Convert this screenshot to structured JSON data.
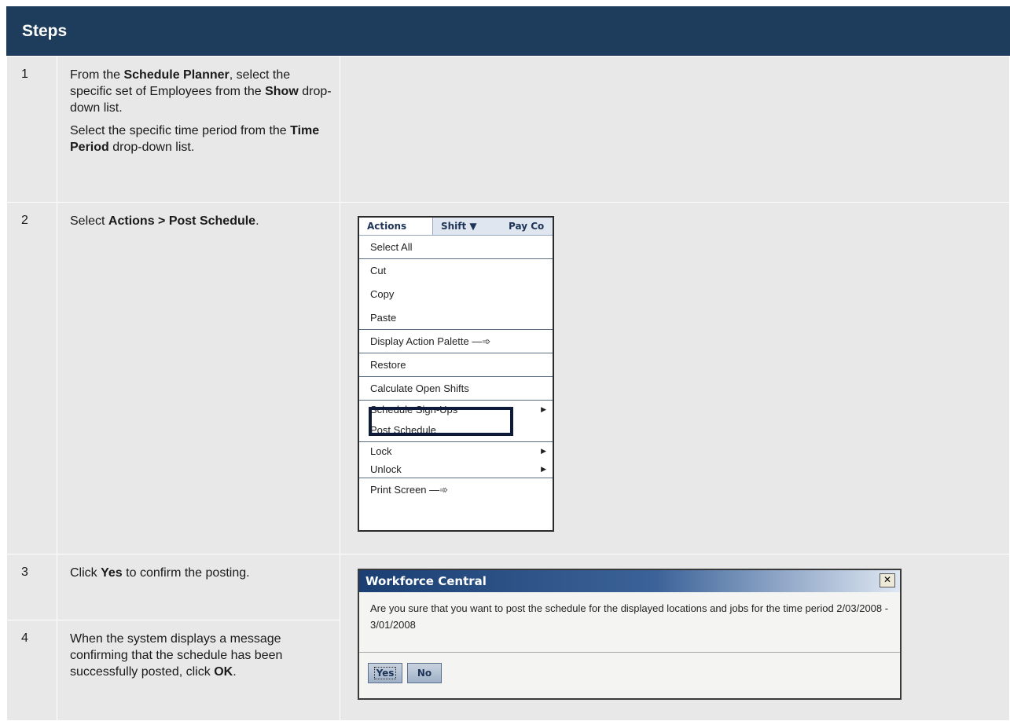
{
  "header": {
    "title": "Steps"
  },
  "steps": [
    {
      "number": "1",
      "paragraphs": [
        [
          {
            "t": "From the "
          },
          {
            "t": "Schedule Planner",
            "b": true
          },
          {
            "t": ", select the specific set of Employees from the "
          },
          {
            "t": "Show",
            "b": true
          },
          {
            "t": " drop-down list."
          }
        ],
        [
          {
            "t": "Select the specific time period from the "
          },
          {
            "t": "Time Period",
            "b": true
          },
          {
            "t": " drop-down list."
          }
        ]
      ]
    },
    {
      "number": "2",
      "paragraphs": [
        [
          {
            "t": "Select "
          },
          {
            "t": "Actions > Post Schedule",
            "b": true
          },
          {
            "t": "."
          }
        ]
      ]
    },
    {
      "number": "3",
      "paragraphs": [
        [
          {
            "t": "Click "
          },
          {
            "t": "Yes",
            "b": true
          },
          {
            "t": " to confirm the posting."
          }
        ]
      ]
    },
    {
      "number": "4",
      "paragraphs": [
        [
          {
            "t": "When the system displays a message confirming that the schedule has been successfully posted, click "
          },
          {
            "t": "OK",
            "b": true
          },
          {
            "t": "."
          }
        ]
      ]
    }
  ],
  "actions_menu": {
    "menubar": {
      "actions": "Actions",
      "shift": "Shift ▼",
      "pay": "Pay Co"
    },
    "items": [
      {
        "label": "Select All"
      },
      {
        "label": "Cut"
      },
      {
        "label": "Copy"
      },
      {
        "label": "Paste"
      },
      {
        "label": "Display Action Palette —➾"
      },
      {
        "label": "Restore"
      },
      {
        "label": "Calculate Open Shifts"
      },
      {
        "label": "Schedule Sign-Ups",
        "submenu": true
      },
      {
        "label": "Post Schedule",
        "highlighted": true
      },
      {
        "label": "Lock",
        "submenu": true
      },
      {
        "label": "Unlock",
        "submenu": true
      },
      {
        "label": "Print Screen —➾"
      }
    ]
  },
  "dialog": {
    "title": "Workforce Central",
    "close": "✕",
    "message": "Are you sure that you want to post the schedule for the displayed locations and jobs for the time period 2/03/2008 - 3/01/2008",
    "yes_label": "Yes",
    "no_label": "No"
  },
  "colors": {
    "header_bg": "#1e3d5c",
    "cell_bg": "#e8e8e8",
    "dialog_title": "#1b3f72"
  }
}
